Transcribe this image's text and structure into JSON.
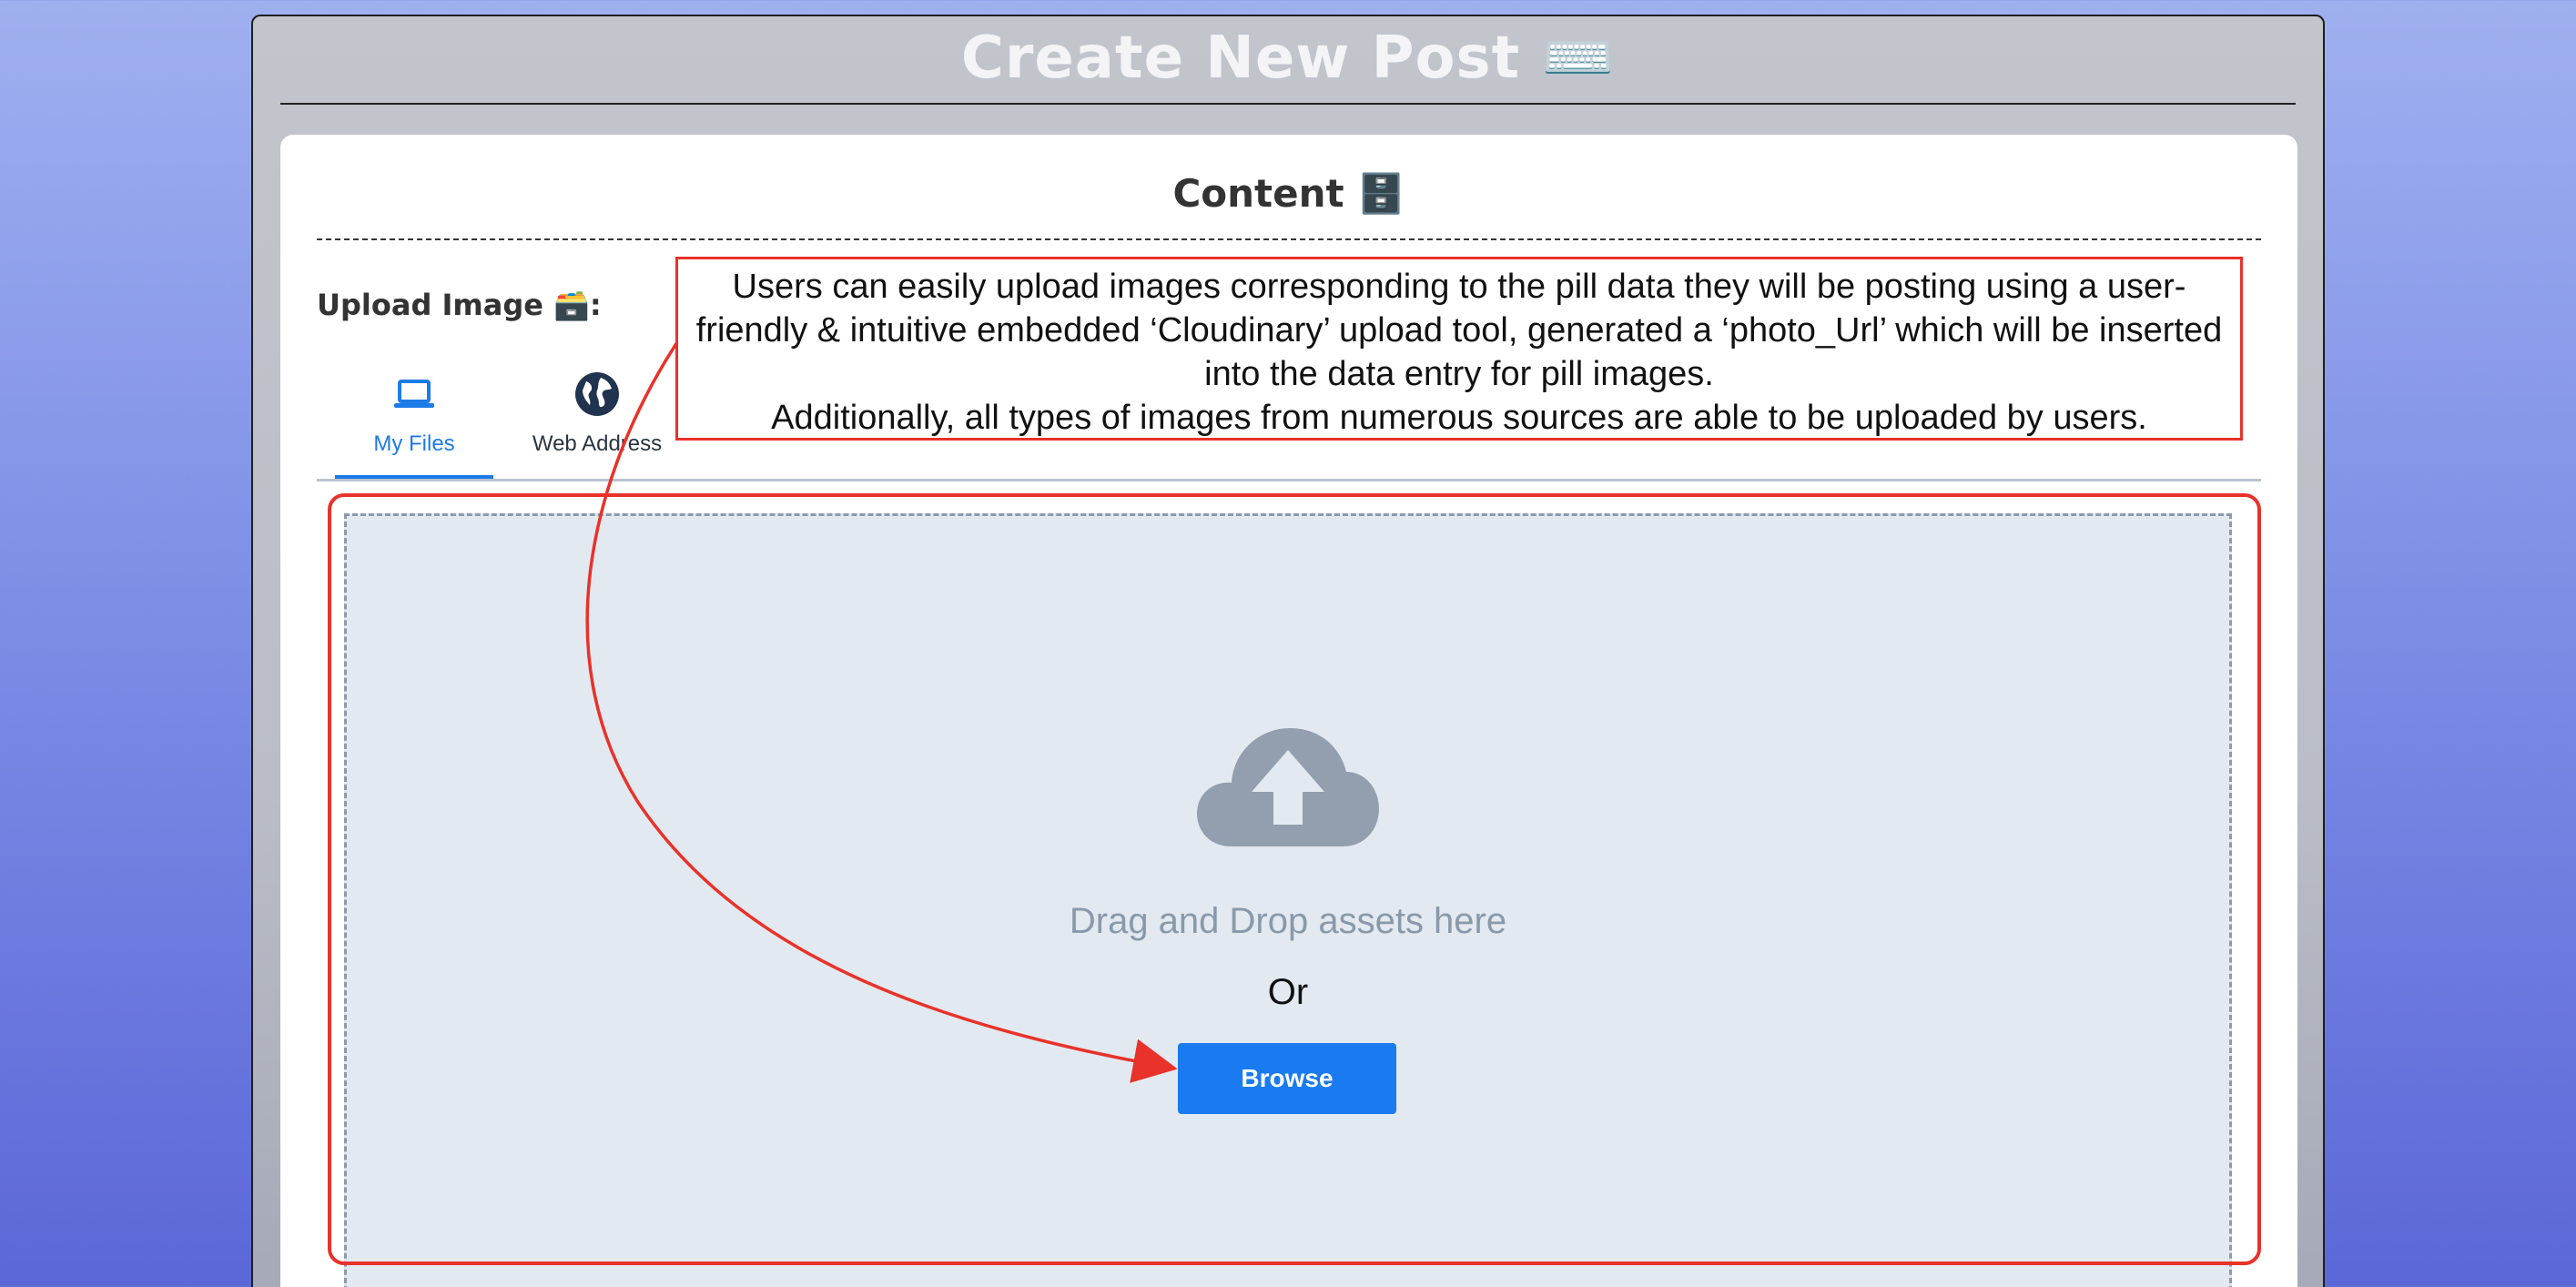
{
  "page": {
    "title": "Create New Post ⌨️"
  },
  "content_section": {
    "title": "Content 🗄️",
    "upload_label": "Upload Image 🗃️:"
  },
  "upload_widget": {
    "tabs": [
      {
        "label": "My Files",
        "icon": "laptop-icon",
        "active": true
      },
      {
        "label": "Web Address",
        "icon": "globe-icon",
        "active": false
      }
    ],
    "dropzone": {
      "icon": "cloud-upload-icon",
      "drag_text": "Drag and Drop assets here",
      "or_text": "Or",
      "browse_label": "Browse"
    }
  },
  "annotation": {
    "lines": [
      "Users can easily upload images corresponding to the pill data they will be posting using a user-friendly & intuitive embedded ‘Cloudinary’ upload tool, generated a ‘photo_Url’ which will be inserted into the data entry for pill images.",
      "Additionally, all types of images from numerous sources are able to be uploaded by users."
    ]
  },
  "colors": {
    "accent": "#1a7bf0",
    "annotation": "#e8322a",
    "dropzone_bg": "#e3e9f0",
    "cloud": "#939faf"
  }
}
